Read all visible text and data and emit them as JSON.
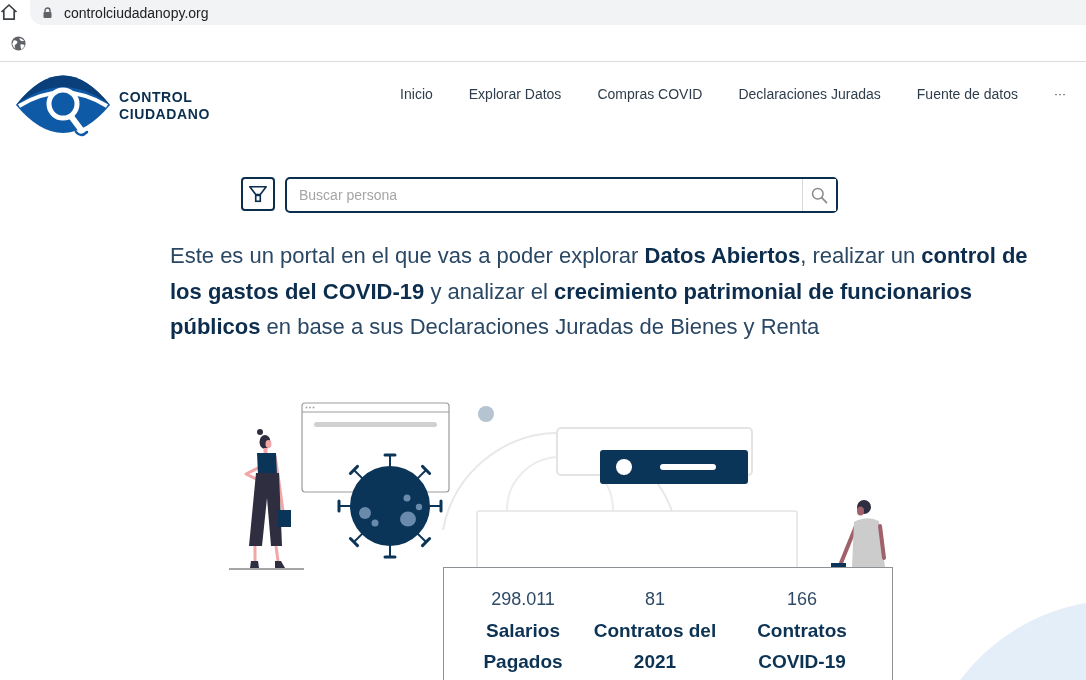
{
  "browser": {
    "url": "controlciudadanopy.org"
  },
  "header": {
    "logo_text": "CONTROL CIUDADANO",
    "nav": [
      {
        "label": "Inicio"
      },
      {
        "label": "Explorar Datos"
      },
      {
        "label": "Compras COVID"
      },
      {
        "label": "Declaraciones Juradas"
      },
      {
        "label": "Fuente de datos"
      }
    ],
    "more": "···"
  },
  "search": {
    "placeholder": "Buscar persona"
  },
  "intro": "Este es un portal en el que vas a poder explorar **Datos Abiertos**, realizar un **control de los gastos del COVID-19** y analizar el **crecimiento patrimonial de funcionarios públicos** en base a sus Declaraciones Juradas de Bienes y Renta",
  "stats": [
    {
      "value": "298.011",
      "label": "Salarios Pagados"
    },
    {
      "value": "81",
      "label": "Contratos del 2021"
    },
    {
      "value": "166",
      "label": "Contratos COVID-19"
    }
  ]
}
